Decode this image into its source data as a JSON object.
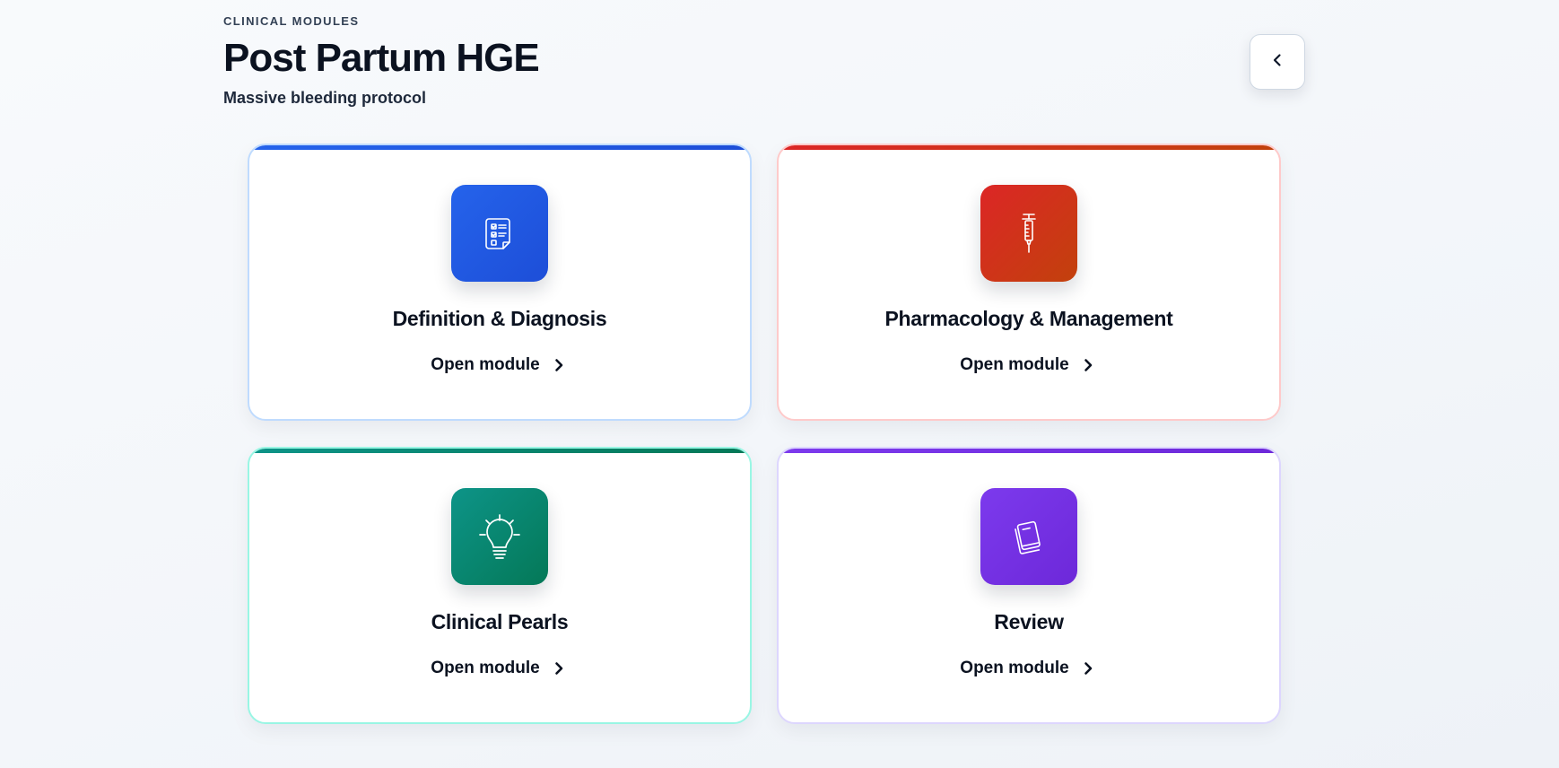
{
  "header": {
    "eyebrow": "CLINICAL MODULES",
    "title": "Post Partum HGE",
    "subtitle": "Massive bleeding protocol",
    "back_icon": "chevron-left-icon"
  },
  "modules": [
    {
      "title": "Definition & Diagnosis",
      "link_label": "Open module",
      "icon": "checklist-icon",
      "accent": "#2563eb"
    },
    {
      "title": "Pharmacology & Management",
      "link_label": "Open module",
      "icon": "syringe-icon",
      "accent": "#dc2626"
    },
    {
      "title": "Clinical Pearls",
      "link_label": "Open module",
      "icon": "lightbulb-icon",
      "accent": "#0d9488"
    },
    {
      "title": "Review",
      "link_label": "Open module",
      "icon": "book-icon",
      "accent": "#7c3aed"
    }
  ]
}
